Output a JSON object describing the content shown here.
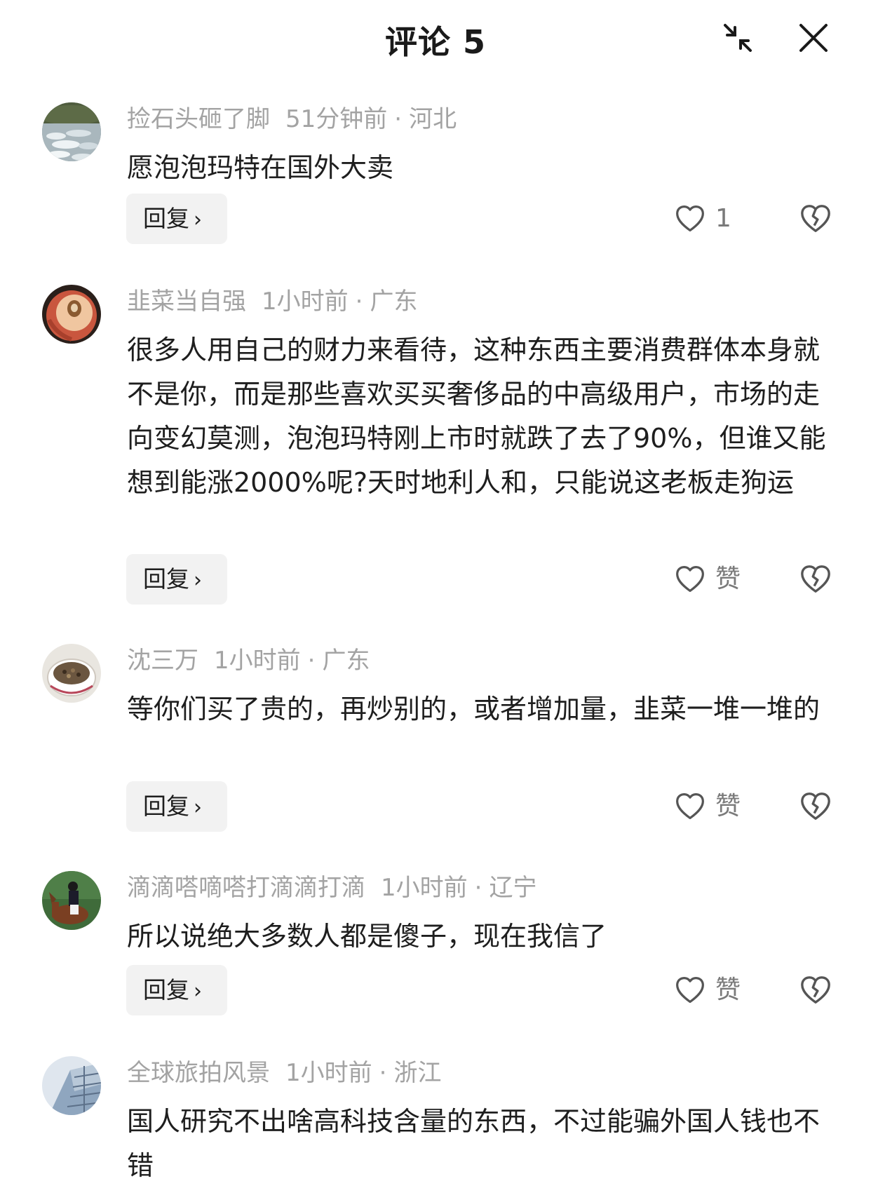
{
  "header": {
    "title": "评论 5"
  },
  "comments": [
    {
      "user": "捡石头砸了脚",
      "time": "51分钟前",
      "sep": "·",
      "location": "河北",
      "text": "愿泡泡玛特在国外大卖",
      "reply_label": "回复",
      "like_label": "1",
      "avatar": "landscape-rocks"
    },
    {
      "user": "韭菜当自强",
      "time": "1小时前",
      "sep": "·",
      "location": "广东",
      "text": "很多人用自己的财力来看待，这种东西主要消费群体本身就不是你，而是那些喜欢买买奢侈品的中高级用户，市场的走向变幻莫测，泡泡玛特刚上市时就跌了去了90%，但谁又能想到能涨2000%呢?天时地利人和，只能说这老板走狗运",
      "reply_label": "回复",
      "like_label": "赞",
      "avatar": "peach"
    },
    {
      "user": "沈三万",
      "time": "1小时前",
      "sep": "·",
      "location": "广东",
      "text": "等你们买了贵的，再炒别的，或者增加量，韭菜一堆一堆的",
      "reply_label": "回复",
      "like_label": "赞",
      "avatar": "tea-bowl"
    },
    {
      "user": "滴滴嗒嘀嗒打滴滴打滴",
      "time": "1小时前",
      "sep": "·",
      "location": "辽宁",
      "text": "所以说绝大多数人都是傻子，现在我信了",
      "reply_label": "回复",
      "like_label": "赞",
      "avatar": "horse-rider"
    },
    {
      "user": "全球旅拍风景",
      "time": "1小时前",
      "sep": "·",
      "location": "浙江",
      "text": "国人研究不出啥高科技含量的东西，不过能骗外国人钱也不错",
      "reply_label": "回复",
      "like_label": "赞",
      "avatar": "building"
    }
  ],
  "colors": {
    "meta": "#a3a3a3",
    "text": "#1e1e1e",
    "reply_bg": "#f2f2f2",
    "icon": "#555555"
  },
  "icons": [
    "collapse-icon",
    "close-icon",
    "heart-icon",
    "broken-heart-icon",
    "chevron-right-icon"
  ]
}
